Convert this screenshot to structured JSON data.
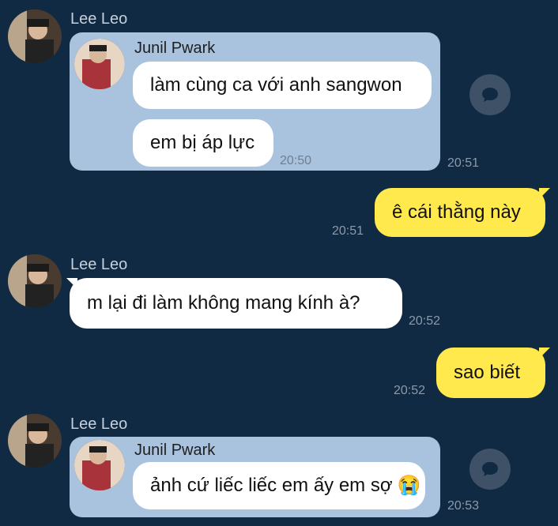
{
  "messages": [
    {
      "sender": "Lee Leo",
      "forwarded_from": "Junil Pwark",
      "lines": [
        "làm cùng ca với anh sangwon",
        "em bị áp lực"
      ],
      "inner_time": "20:50",
      "time": "20:51"
    },
    {
      "text": "ê cái thằng này",
      "time": "20:51"
    },
    {
      "sender": "Lee Leo",
      "text": "m lại đi làm không mang kính à?",
      "time": "20:52"
    },
    {
      "text": "sao biết",
      "time": "20:52"
    },
    {
      "sender": "Lee Leo",
      "forwarded_from": "Junil Pwark",
      "text": "ảnh cứ liếc liếc em ấy em sợ",
      "emoji": "😭",
      "time": "20:53"
    }
  ],
  "colors": {
    "background": "#0f2a42",
    "forward_card": "#a9c2de",
    "incoming_bubble": "#ffffff",
    "outgoing_bubble": "#ffe94d"
  },
  "icons": [
    "avatar",
    "share-icon"
  ]
}
